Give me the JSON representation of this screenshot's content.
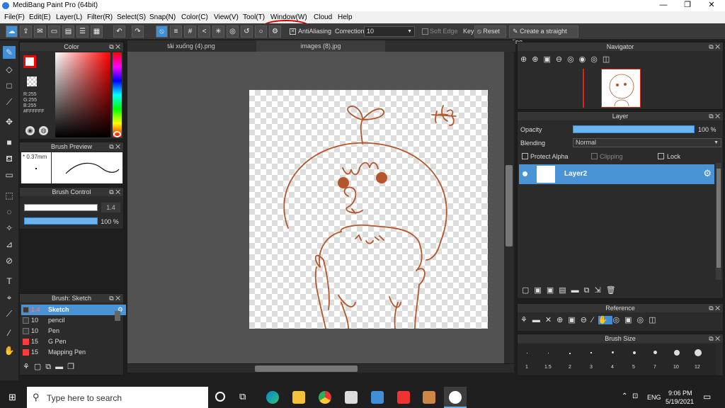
{
  "window": {
    "title": "MediBang Paint Pro (64bit)",
    "minimize": "—",
    "maximize": "❐",
    "close": "✕"
  },
  "menu": [
    "File(F)",
    "Edit(E)",
    "Layer(L)",
    "Filter(R)",
    "Select(S)",
    "Snap(N)",
    "Color(C)",
    "View(V)",
    "Tool(T)",
    "Window(W)",
    "Cloud",
    "Help"
  ],
  "toolbar": {
    "antialiasing": "AntiAliasing",
    "correction_label": "Correction",
    "correction_value": "10",
    "soft_edge": "Soft Edge",
    "key": "Key",
    "reset": "Reset",
    "straight_line": "Create a straight line"
  },
  "tabs": [
    "tải xuống (4).png",
    "images (8).jpg"
  ],
  "color": {
    "title": "Color",
    "r": "R:255",
    "g": "G:255",
    "b": "B:255",
    "hex": "#FFFFFF",
    "primary": "#ff0000"
  },
  "brush_preview": {
    "title": "Brush Preview",
    "size": "0.37mm"
  },
  "brush_control": {
    "title": "Brush Control",
    "size_value": "1.4",
    "opacity_value": "100 %"
  },
  "brush_list": {
    "title": "Brush: Sketch",
    "items": [
      {
        "size": "1.4",
        "name": "Sketch",
        "color": "#3a3a3a",
        "selected": true
      },
      {
        "size": "10",
        "name": "pencil",
        "color": "#3a3a3a",
        "selected": false
      },
      {
        "size": "10",
        "name": "Pen",
        "color": "#3a3a3a",
        "selected": false
      },
      {
        "size": "15",
        "name": "G Pen",
        "color": "#ff3b3b",
        "selected": false
      },
      {
        "size": "15",
        "name": "Mapping Pen",
        "color": "#ff3b3b",
        "selected": false
      }
    ]
  },
  "navigator": {
    "title": "Navigator"
  },
  "layer": {
    "title": "Layer",
    "opacity_label": "Opacity",
    "opacity_value": "100 %",
    "blending_label": "Blending",
    "blending_value": "Normal",
    "protect_alpha": "Protect Alpha",
    "clipping": "Clipping",
    "lock": "Lock",
    "layer_name": "Layer2"
  },
  "reference": {
    "title": "Reference"
  },
  "brush_size": {
    "title": "Brush Size",
    "sizes": [
      "1",
      "1.5",
      "2",
      "3",
      "4",
      "5",
      "7",
      "10",
      "12"
    ]
  },
  "taskbar": {
    "search_placeholder": "Type here to search",
    "lang": "ENG",
    "time": "9:06 PM",
    "date": "5/19/2021"
  },
  "canvas_text": "Hg"
}
